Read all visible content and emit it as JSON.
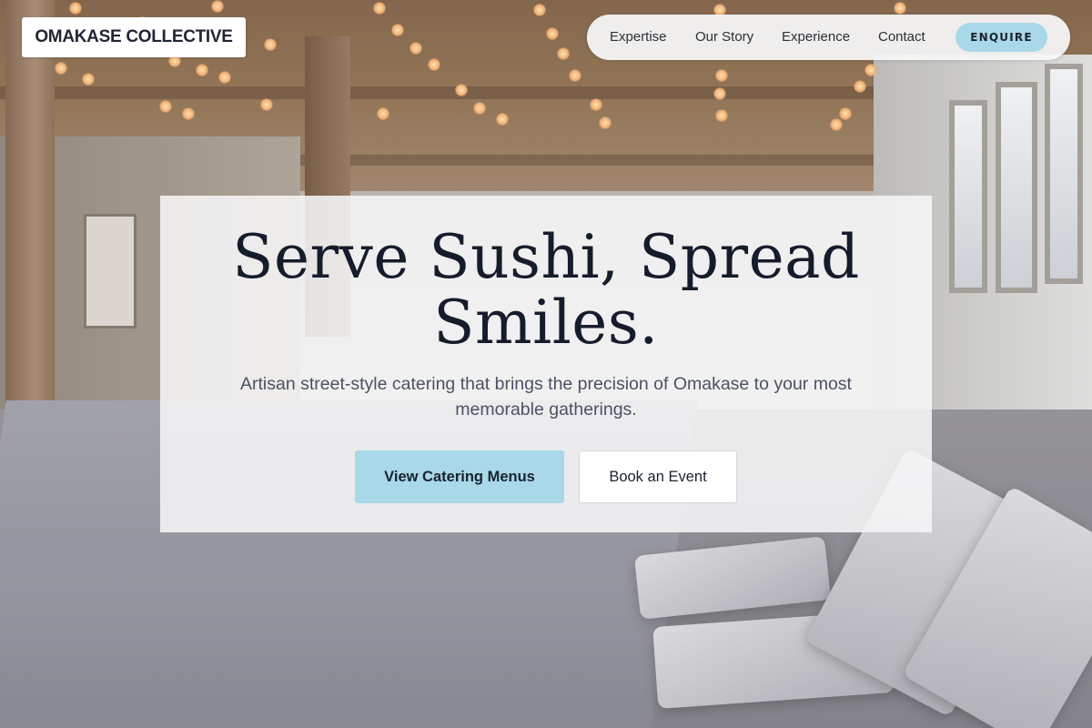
{
  "header": {
    "brand": "OMAKASE COLLECTIVE",
    "nav": {
      "items": [
        {
          "label": "Expertise"
        },
        {
          "label": "Our Story"
        },
        {
          "label": "Experience"
        },
        {
          "label": "Contact"
        }
      ],
      "cta_label": "ENQUIRE"
    }
  },
  "hero": {
    "title_line1": "Serve Sushi, Spread",
    "title_line2": "Smiles.",
    "subtitle_line1": "Artisan street-style catering that brings the precision of Omakase to your most",
    "subtitle_line2": "memorable gatherings.",
    "primary_button": "View Catering Menus",
    "secondary_button": "Book an Event"
  },
  "colors": {
    "accent": "#a9d8e8",
    "text_dark": "#151c2b",
    "text_muted": "#4a5263",
    "card_bg": "#f6f6f7"
  }
}
